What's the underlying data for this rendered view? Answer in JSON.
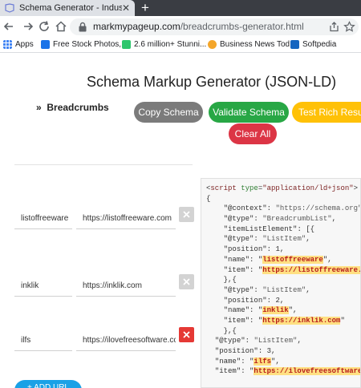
{
  "browser": {
    "tab_title": "Schema Generator - Industry's Le",
    "new_tab": "+",
    "url_host": "markmypageup.com",
    "url_path": "/breadcrumbs-generator.html",
    "bookmarks": [
      {
        "label": "Apps",
        "icon": "apps-grid-icon",
        "color": "#5f6368"
      },
      {
        "label": "Free Stock Photos,...",
        "icon": "pexels-icon",
        "color": "#1a73e8"
      },
      {
        "label": "2.6 million+ Stunni...",
        "icon": "pixabay-icon",
        "color": "#2ec66d"
      },
      {
        "label": "Business News Tod...",
        "icon": "news-icon",
        "color": "#f4a62a"
      },
      {
        "label": "Softpedia",
        "icon": "softpedia-icon",
        "color": "#1565c0"
      }
    ]
  },
  "page": {
    "title": "Schema Markup Generator (JSON-LD)",
    "section_heading": "Breadcrumbs",
    "section_marker": "»",
    "buttons": {
      "copy": "Copy Schema",
      "validate": "Validate Schema",
      "test": "Test Rich Results",
      "clear": "Clear All",
      "add": "+ ADD URL"
    },
    "colors": {
      "copy": "#7b7b7b",
      "validate": "#28a745",
      "test": "#ffc107",
      "clear": "#dc3545",
      "add": "#1aa1e6"
    }
  },
  "breadcrumbs": [
    {
      "name": "listoffreeware",
      "url": "https://listoffreeware.com"
    },
    {
      "name": "inklik",
      "url": "https://inklik.com"
    },
    {
      "name": "ilfs",
      "url": "https://ilovefreesoftware.cc"
    }
  ],
  "code": {
    "script_tag": "script",
    "type_attr": "type",
    "type_value": "\"application/ld+json\"",
    "context_key": "\"@context\"",
    "context_value": "\"https://schema.org\"",
    "type_key": "\"@type\"",
    "list_type": "\"BreadcrumbList\"",
    "element_key": "\"itemListElement\"",
    "item_type": "\"ListItem\"",
    "position_key": "\"position\"",
    "name_key": "\"name\"",
    "item_key": "\"item\"",
    "positions": [
      "1",
      "2",
      "3"
    ],
    "names": [
      "listoffreeware",
      "inklik",
      "ilfs"
    ],
    "items": [
      "https://listoffreeware.com",
      "https://inklik.com",
      "https://ilovefreesoftware.cc"
    ]
  }
}
